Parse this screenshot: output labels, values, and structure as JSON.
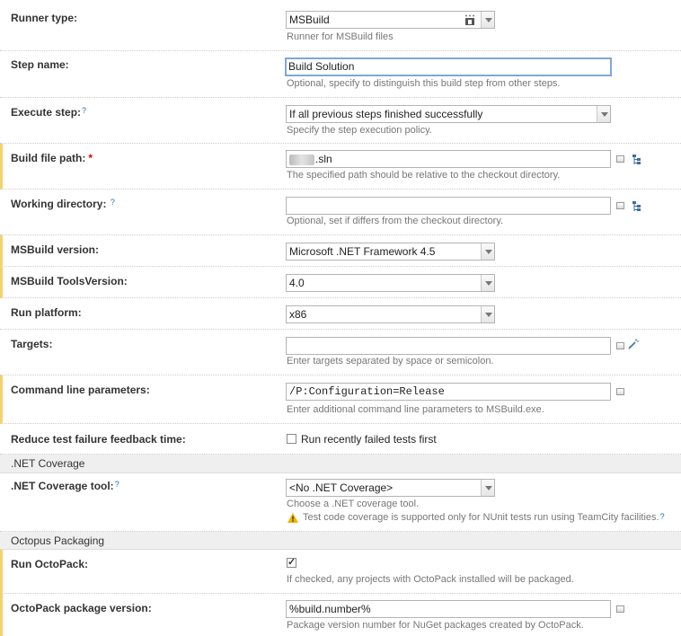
{
  "runner_type": {
    "label": "Runner type:",
    "value": "MSBuild",
    "note": "Runner for MSBuild files"
  },
  "step_name": {
    "label": "Step name:",
    "value": "Build Solution",
    "note": "Optional, specify to distinguish this build step from other steps."
  },
  "execute_step": {
    "label": "Execute step:",
    "value": "If all previous steps finished successfully",
    "note": "Specify the step execution policy."
  },
  "build_file_path": {
    "label": "Build file path:",
    "required": "*",
    "value": ".sln",
    "note": "The specified path should be relative to the checkout directory."
  },
  "working_directory": {
    "label": "Working directory:",
    "value": "",
    "note": "Optional, set if differs from the checkout directory."
  },
  "msbuild_version": {
    "label": "MSBuild version:",
    "value": "Microsoft .NET Framework 4.5"
  },
  "msbuild_tools_version": {
    "label": "MSBuild ToolsVersion:",
    "value": "4.0"
  },
  "run_platform": {
    "label": "Run platform:",
    "value": "x86"
  },
  "targets": {
    "label": "Targets:",
    "value": "",
    "note": "Enter targets separated by space or semicolon."
  },
  "command_line": {
    "label": "Command line parameters:",
    "value": "/P:Configuration=Release",
    "note": "Enter additional command line parameters to MSBuild.exe."
  },
  "reduce_feedback": {
    "label": "Reduce test failure feedback time:",
    "checkbox_label": "Run recently failed tests first",
    "checked": false
  },
  "net_coverage_section": {
    "title": ".NET Coverage"
  },
  "net_coverage_tool": {
    "label": ".NET Coverage tool:",
    "value": "<No .NET Coverage>",
    "note": "Choose a .NET coverage tool.",
    "warning": "Test code coverage is supported only for NUnit tests run using TeamCity facilities."
  },
  "octopus_section": {
    "title": "Octopus Packaging"
  },
  "run_octopack": {
    "label": "Run OctoPack:",
    "checked": true,
    "note": "If checked, any projects with OctoPack installed will be packaged."
  },
  "octopack_version": {
    "label": "OctoPack package version:",
    "value": "%build.number%",
    "note": "Package version number for NuGet packages created by OctoPack."
  },
  "help_glyph": "?"
}
